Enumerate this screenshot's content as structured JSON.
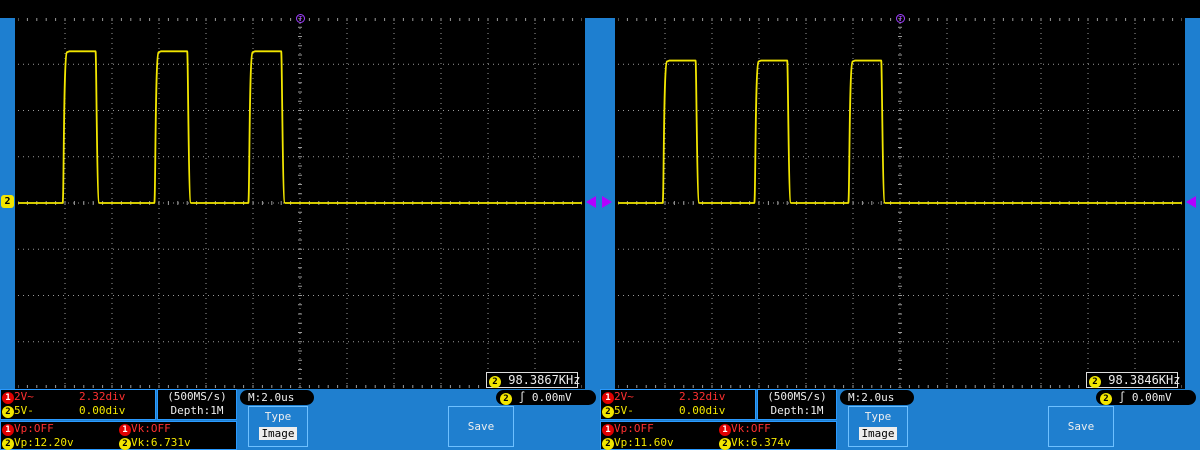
{
  "scopes": [
    {
      "id": "left",
      "channel_label": "2",
      "trigger_marker": "Ⓣ",
      "frequency": "98.3867KHz",
      "ch1_scale": "2V~",
      "ch1_offset": "2.32div",
      "ch2_scale": "5V-",
      "ch2_offset": "0.00div",
      "sample_rate": "(500MS/s)",
      "depth": "Depth:1M",
      "timebase": "M:2.0us",
      "trigger_level": "0.00mV",
      "vp1": "Vp:OFF",
      "vk1": "Vk:OFF",
      "vp2": "Vp:12.20v",
      "vk2": "Vk:6.731v",
      "type_label": "Type",
      "type_value": "Image",
      "save_label": "Save",
      "high_level_div": 3.28,
      "low_level_div": 0.0,
      "edges_us": [
        1.9,
        3.3,
        5.8,
        7.2,
        9.8,
        11.2
      ]
    },
    {
      "id": "right",
      "channel_label": "2",
      "trigger_marker": "Ⓣ",
      "frequency": "98.3846KHz",
      "ch1_scale": "2V~",
      "ch1_offset": "2.32div",
      "ch2_scale": "5V-",
      "ch2_offset": "0.00div",
      "sample_rate": "(500MS/s)",
      "depth": "Depth:1M",
      "timebase": "M:2.0us",
      "trigger_level": "0.00mV",
      "vp1": "Vp:OFF",
      "vk1": "Vk:OFF",
      "vp2": "Vp:11.60v",
      "vk2": "Vk:6.374v",
      "type_label": "Type",
      "type_value": "Image",
      "save_label": "Save",
      "high_level_div": 3.08,
      "low_level_div": 0.0,
      "edges_us": [
        1.9,
        3.3,
        5.8,
        7.2,
        9.8,
        11.2
      ]
    }
  ],
  "colors": {
    "trace": "#f2e600",
    "grid": "#9a9a9a",
    "panel": "#1f7fcf"
  },
  "icons": {
    "ch1": "circle-1-icon",
    "ch2": "circle-2-icon",
    "trigger_edge": "rising-edge-icon"
  }
}
